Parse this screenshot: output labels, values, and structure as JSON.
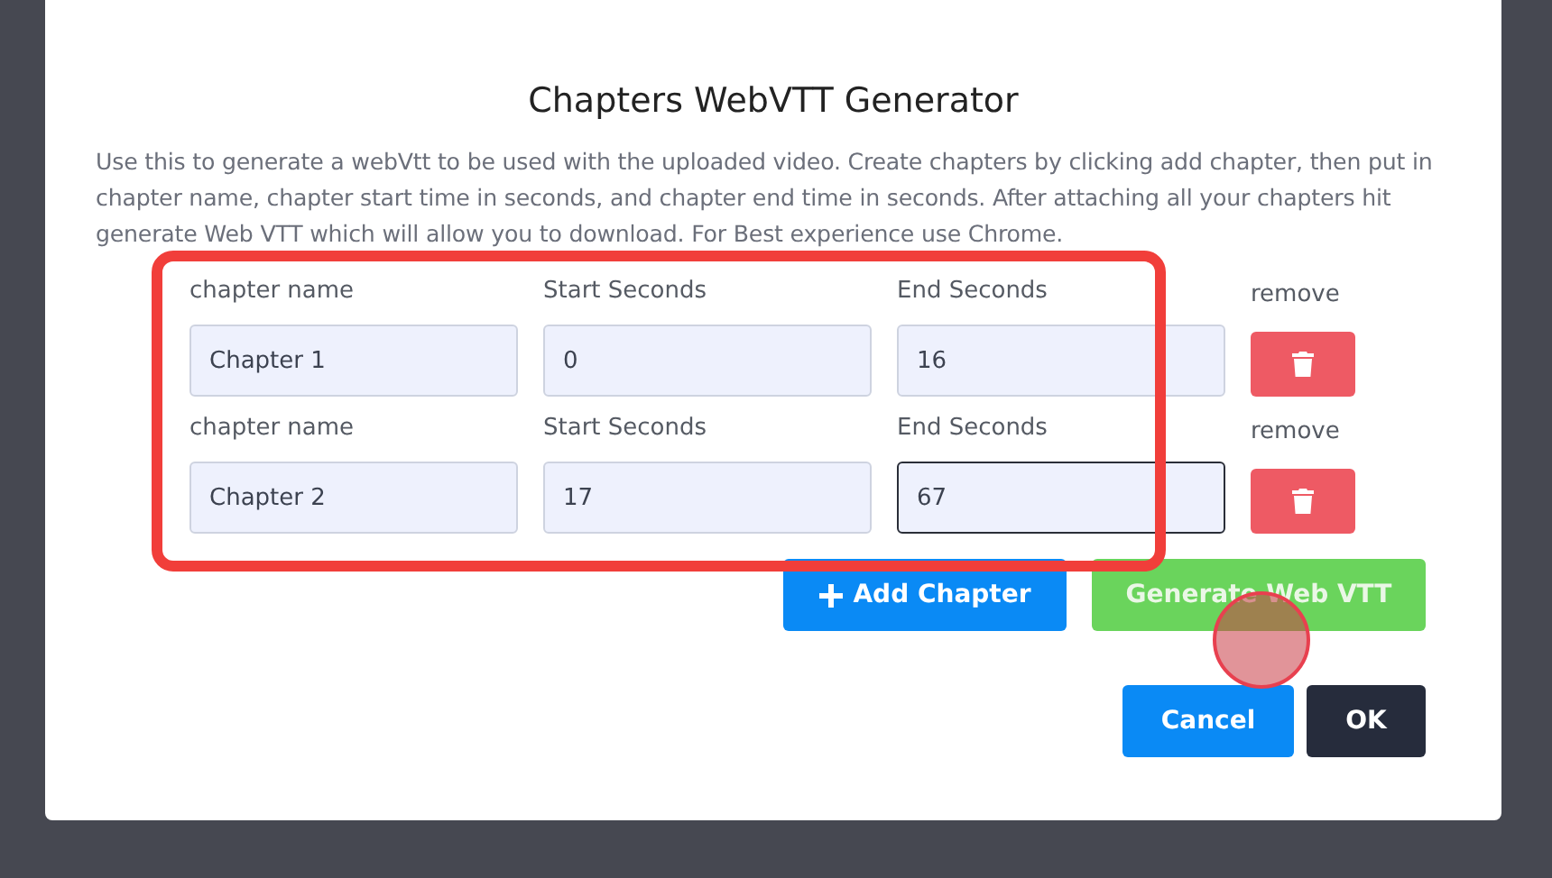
{
  "dialog": {
    "title": "Chapters WebVTT Generator",
    "description": "Use this to generate a webVtt to be used with the uploaded video. Create chapters by clicking add chapter, then put in chapter name, chapter start time in seconds, and chapter end time in seconds. After attaching all your chapters hit generate Web VTT which will allow you to download. For Best experience use Chrome."
  },
  "chapters": [
    {
      "fields": [
        {
          "label": "chapter name",
          "value": "Chapter 1",
          "focused": false
        },
        {
          "label": "Start Seconds",
          "value": "0",
          "focused": false
        },
        {
          "label": "End Seconds",
          "value": "16",
          "focused": false
        }
      ],
      "remove_label": "remove"
    },
    {
      "fields": [
        {
          "label": "chapter name",
          "value": "Chapter 2",
          "focused": false
        },
        {
          "label": "Start Seconds",
          "value": "17",
          "focused": false
        },
        {
          "label": "End Seconds",
          "value": "67",
          "focused": true
        }
      ],
      "remove_label": "remove"
    }
  ],
  "actions": [
    {
      "label": "Add Chapter",
      "kind": "add"
    },
    {
      "label": "Generate Web VTT",
      "kind": "generate"
    }
  ],
  "footer_buttons": [
    {
      "label": "Cancel",
      "kind": "secondary"
    },
    {
      "label": "OK",
      "kind": "primary"
    }
  ]
}
